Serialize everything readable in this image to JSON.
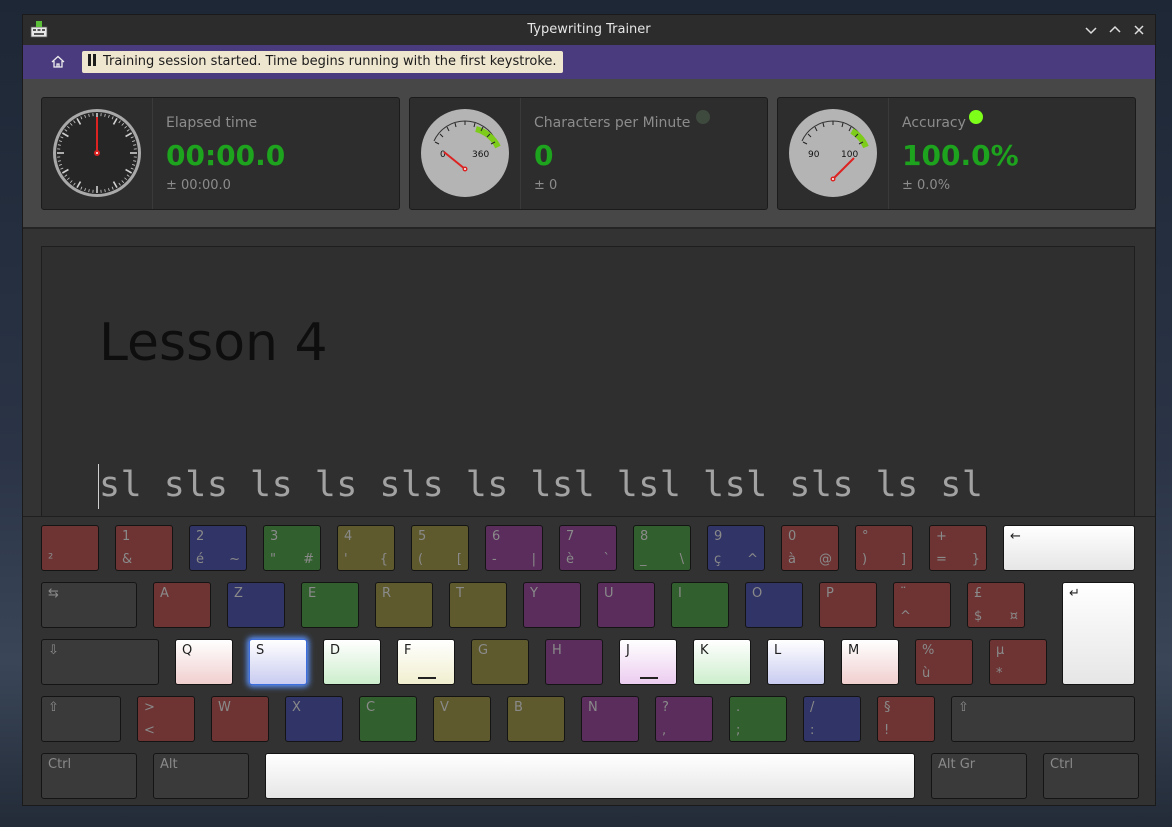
{
  "window": {
    "title": "Typewriting Trainer"
  },
  "icons": {
    "app": "keyboard-app-icon",
    "home": "home-icon",
    "minimize": "chevron-down-icon",
    "maximize": "chevron-up-icon",
    "close": "close-icon",
    "pause": "pause-icon"
  },
  "toolbar": {
    "notice": "Training session started. Time begins running with the first keystroke."
  },
  "stats": {
    "elapsed": {
      "label": "Elapsed time",
      "value": "00:00.0",
      "spread": "± 00:00.0"
    },
    "cpm": {
      "label": "Characters per Minute",
      "value": "0",
      "spread": "± 0",
      "gauge_min": "0",
      "gauge_max": "360",
      "led_color": "#3f4a3f"
    },
    "accuracy": {
      "label": "Accuracy",
      "value": "100.0%",
      "spread": "± 0.0%",
      "gauge_min": "90",
      "gauge_max": "100",
      "led_color": "#7dff1a"
    }
  },
  "lesson": {
    "title": "Lesson 4",
    "text": "sl sls ls ls sls ls lsl lsl lsl sls ls sl"
  },
  "keyboard": {
    "rows": [
      [
        {
          "top": "",
          "bot": "²",
          "br": "",
          "color": "#6e3434",
          "w": 58
        },
        {
          "top": "1",
          "bot": "&",
          "br": "",
          "color": "#6e3434",
          "w": 58
        },
        {
          "top": "2",
          "bot": "é",
          "br": "~",
          "color": "#313466",
          "w": 58
        },
        {
          "top": "3",
          "bot": "\"",
          "br": "#",
          "color": "#325f2e",
          "w": 58
        },
        {
          "top": "4",
          "bot": "'",
          "br": "{",
          "color": "#5e5a2e",
          "w": 58
        },
        {
          "top": "5",
          "bot": "(",
          "br": "[",
          "color": "#5e5a2e",
          "w": 58
        },
        {
          "top": "6",
          "bot": "-",
          "br": "|",
          "color": "#5a2d5c",
          "w": 58
        },
        {
          "top": "7",
          "bot": "è",
          "br": "`",
          "color": "#5a2d5c",
          "w": 58
        },
        {
          "top": "8",
          "bot": "_",
          "br": "\\",
          "color": "#325f2e",
          "w": 58
        },
        {
          "top": "9",
          "bot": "ç",
          "br": "^",
          "color": "#313466",
          "w": 58
        },
        {
          "top": "0",
          "bot": "à",
          "br": "@",
          "color": "#6e3434",
          "w": 58
        },
        {
          "top": "°",
          "bot": ")",
          "br": "]",
          "color": "#6e3434",
          "w": 58
        },
        {
          "top": "+",
          "bot": "=",
          "br": "}",
          "color": "#6e3434",
          "w": 58
        },
        {
          "top": "←",
          "bot": "",
          "br": "",
          "color": "#e6e6e6",
          "w": 132,
          "lit": true,
          "name": "backspace-key"
        }
      ],
      [
        {
          "top": "⇆",
          "bot": "",
          "br": "",
          "color": "#3a3a3a",
          "w": 96,
          "name": "tab-key"
        },
        {
          "top": "A",
          "bot": "",
          "br": "",
          "color": "#6e3434",
          "w": 58
        },
        {
          "top": "Z",
          "bot": "",
          "br": "",
          "color": "#313466",
          "w": 58
        },
        {
          "top": "E",
          "bot": "",
          "br": "",
          "color": "#325f2e",
          "w": 58
        },
        {
          "top": "R",
          "bot": "",
          "br": "",
          "color": "#5e5a2e",
          "w": 58
        },
        {
          "top": "T",
          "bot": "",
          "br": "",
          "color": "#5e5a2e",
          "w": 58
        },
        {
          "top": "Y",
          "bot": "",
          "br": "",
          "color": "#5a2d5c",
          "w": 58
        },
        {
          "top": "U",
          "bot": "",
          "br": "",
          "color": "#5a2d5c",
          "w": 58
        },
        {
          "top": "I",
          "bot": "",
          "br": "",
          "color": "#325f2e",
          "w": 58
        },
        {
          "top": "O",
          "bot": "",
          "br": "",
          "color": "#313466",
          "w": 58
        },
        {
          "top": "P",
          "bot": "",
          "br": "",
          "color": "#6e3434",
          "w": 58
        },
        {
          "top": "¨",
          "bot": "^",
          "br": "",
          "color": "#6e3434",
          "w": 58
        },
        {
          "top": "£",
          "bot": "$",
          "br": "¤",
          "color": "#6e3434",
          "w": 58
        }
      ],
      [
        {
          "top": "⇩",
          "bot": "",
          "br": "",
          "color": "#3a3a3a",
          "w": 118,
          "name": "caps-lock-key"
        },
        {
          "top": "Q",
          "bot": "",
          "br": "",
          "color": "#f1cfcf",
          "w": 58,
          "lit": true
        },
        {
          "top": "S",
          "bot": "",
          "br": "",
          "color": "#c9ccf0",
          "w": 58,
          "lit": true,
          "glow": true
        },
        {
          "top": "D",
          "bot": "",
          "br": "",
          "color": "#cdeecd",
          "w": 58,
          "lit": true
        },
        {
          "top": "F",
          "bot": "",
          "br": "",
          "color": "#f1efcf",
          "w": 58,
          "lit": true,
          "bar": true
        },
        {
          "top": "G",
          "bot": "",
          "br": "",
          "color": "#5e5a2e",
          "w": 58
        },
        {
          "top": "H",
          "bot": "",
          "br": "",
          "color": "#5a2d5c",
          "w": 58
        },
        {
          "top": "J",
          "bot": "",
          "br": "",
          "color": "#eccdf0",
          "w": 58,
          "lit": true,
          "bar": true
        },
        {
          "top": "K",
          "bot": "",
          "br": "",
          "color": "#cdeecd",
          "w": 58,
          "lit": true
        },
        {
          "top": "L",
          "bot": "",
          "br": "",
          "color": "#c9ccf0",
          "w": 58,
          "lit": true
        },
        {
          "top": "M",
          "bot": "",
          "br": "",
          "color": "#f1cfcf",
          "w": 58,
          "lit": true
        },
        {
          "top": "%",
          "bot": "ù",
          "br": "",
          "color": "#6e3434",
          "w": 58
        },
        {
          "top": "µ",
          "bot": "*",
          "br": "",
          "color": "#6e3434",
          "w": 58
        }
      ],
      [
        {
          "top": "⇧",
          "bot": "",
          "br": "",
          "color": "#3a3a3a",
          "w": 80,
          "name": "left-shift-key"
        },
        {
          "top": ">",
          "bot": "<",
          "br": "",
          "color": "#6e3434",
          "w": 58
        },
        {
          "top": "W",
          "bot": "",
          "br": "",
          "color": "#6e3434",
          "w": 58
        },
        {
          "top": "X",
          "bot": "",
          "br": "",
          "color": "#313466",
          "w": 58
        },
        {
          "top": "C",
          "bot": "",
          "br": "",
          "color": "#325f2e",
          "w": 58
        },
        {
          "top": "V",
          "bot": "",
          "br": "",
          "color": "#5e5a2e",
          "w": 58
        },
        {
          "top": "B",
          "bot": "",
          "br": "",
          "color": "#5e5a2e",
          "w": 58
        },
        {
          "top": "N",
          "bot": "",
          "br": "",
          "color": "#5a2d5c",
          "w": 58
        },
        {
          "top": "?",
          "bot": ",",
          "br": "",
          "color": "#5a2d5c",
          "w": 58
        },
        {
          "top": ".",
          "bot": ";",
          "br": "",
          "color": "#325f2e",
          "w": 58
        },
        {
          "top": "/",
          "bot": ":",
          "br": "",
          "color": "#313466",
          "w": 58
        },
        {
          "top": "§",
          "bot": "!",
          "br": "",
          "color": "#6e3434",
          "w": 58
        },
        {
          "top": "⇧",
          "bot": "",
          "br": "",
          "color": "#3a3a3a",
          "w": 184,
          "name": "right-shift-key"
        }
      ],
      [
        {
          "top": "Ctrl",
          "bot": "",
          "br": "",
          "color": "#3a3a3a",
          "w": 96,
          "name": "left-ctrl-key"
        },
        {
          "top": "Alt",
          "bot": "",
          "br": "",
          "color": "#3a3a3a",
          "w": 96,
          "name": "alt-key"
        },
        {
          "top": "",
          "bot": "",
          "br": "",
          "color": "#e6e6e6",
          "w": 650,
          "lit": true,
          "name": "space-key"
        },
        {
          "top": "Alt Gr",
          "bot": "",
          "br": "",
          "color": "#3a3a3a",
          "w": 96,
          "name": "alt-gr-key"
        },
        {
          "top": "Ctrl",
          "bot": "",
          "br": "",
          "color": "#3a3a3a",
          "w": 96,
          "name": "right-ctrl-key"
        }
      ]
    ],
    "enter": {
      "top": "↵",
      "color": "#e6e6e6"
    }
  }
}
